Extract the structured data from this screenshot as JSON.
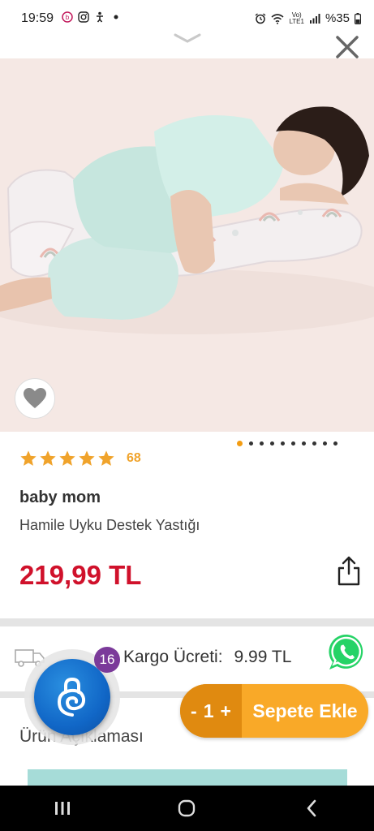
{
  "status_bar": {
    "time": "19:59",
    "network": "LTE1",
    "battery": "%35"
  },
  "product": {
    "rating_count": "68",
    "brand": "baby mom",
    "name": "Hamile Uyku Destek Yastığı",
    "price": "219,99 TL",
    "image_count": 10,
    "active_image": 1,
    "rating": 5
  },
  "shipping": {
    "label": "Kargo Ücreti:",
    "value": "9.99 TL"
  },
  "chat": {
    "badge": "16"
  },
  "description": {
    "title": "Ürün Açıklaması"
  },
  "cart": {
    "decrement": "-",
    "quantity": "1",
    "increment": "+",
    "add_label": "Sepete Ekle"
  },
  "colors": {
    "price": "#d0112b",
    "accent": "#f9a928",
    "accent_dark": "#e08a10",
    "star": "#f0a32b",
    "whatsapp": "#25d366",
    "chat": "#1167c7",
    "badge": "#7b3a9a"
  }
}
